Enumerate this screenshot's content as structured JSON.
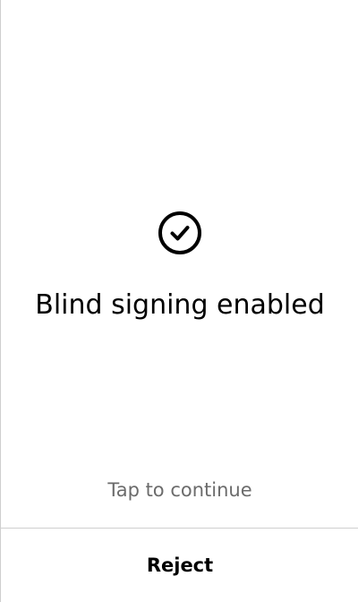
{
  "status": {
    "icon": "check-circle-icon",
    "title": "Blind signing enabled"
  },
  "footer": {
    "hint": "Tap to continue",
    "reject_label": "Reject"
  },
  "colors": {
    "background": "#ffffff",
    "text_primary": "#000000",
    "text_secondary": "#6b6b6b",
    "divider": "#cfcfcf"
  }
}
